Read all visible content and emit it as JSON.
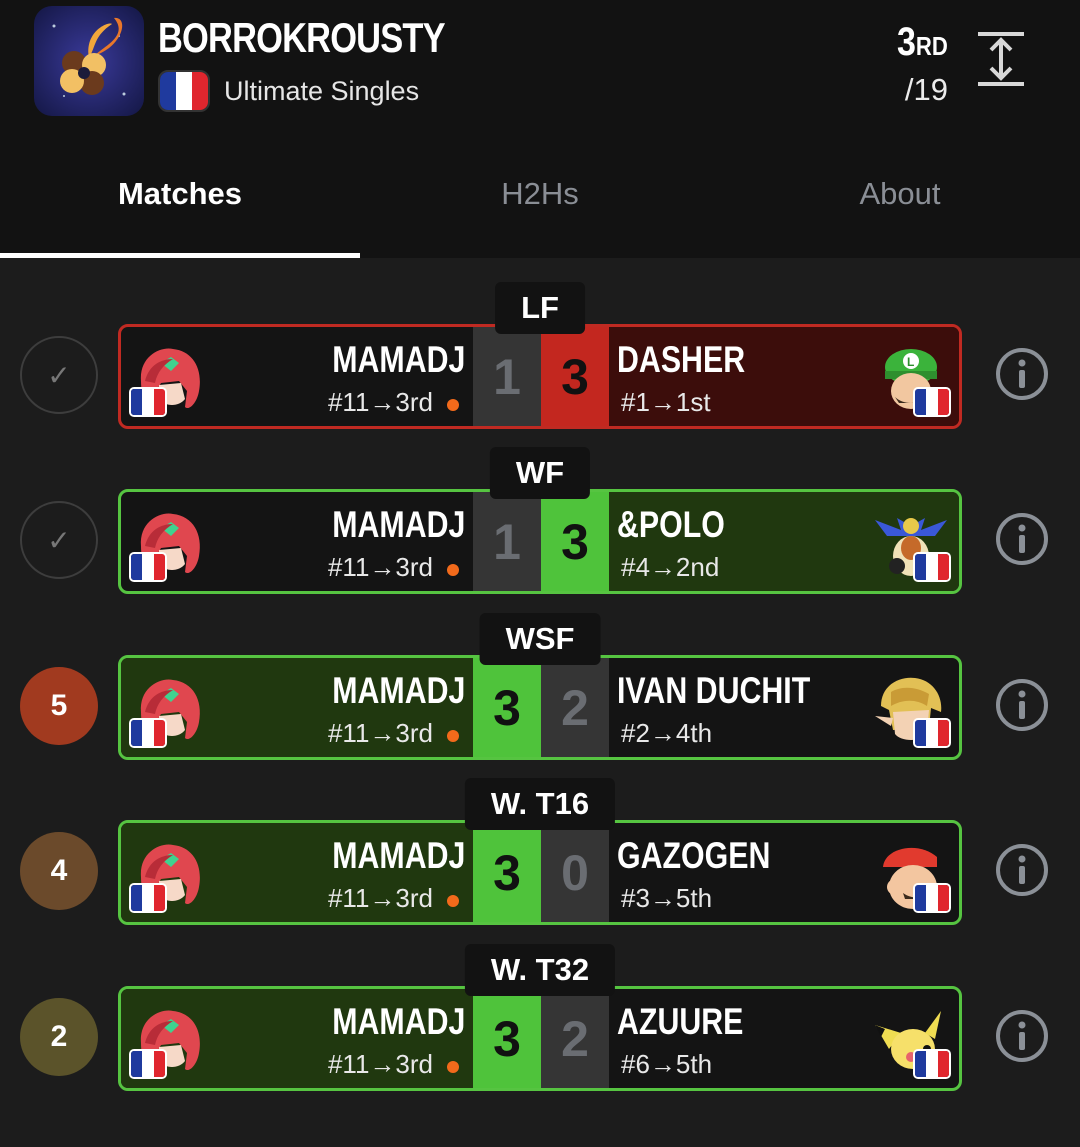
{
  "header": {
    "event_name": "BORROKROUSTY",
    "game": "Ultimate Singles",
    "placement": "3",
    "placement_suffix": "RD",
    "total": "/19",
    "logo_icon": "basque-lauburu-logo",
    "expand_icon": "expand-vertical-icon"
  },
  "tabs": [
    {
      "label": "Matches",
      "active": true
    },
    {
      "label": "H2Hs",
      "active": false
    },
    {
      "label": "About",
      "active": false
    }
  ],
  "colors": {
    "win": "#4fc33b",
    "loss": "#c3271f",
    "seed_dot": "#f26a1b"
  },
  "matches": [
    {
      "round": "LF",
      "status": {
        "type": "check",
        "label": "✓"
      },
      "left": {
        "name": "MAMADJ",
        "seed": "#11→3rd",
        "character": "pyra-icon",
        "flag": "fr"
      },
      "right": {
        "name": "DASHER",
        "seed": "#1→1st",
        "character": "luigi-icon",
        "flag": "fr"
      },
      "score_left": "1",
      "score_right": "3",
      "result": "loss"
    },
    {
      "round": "WF",
      "status": {
        "type": "check",
        "label": "✓"
      },
      "left": {
        "name": "MAMADJ",
        "seed": "#11→3rd",
        "character": "pyra-icon",
        "flag": "fr"
      },
      "right": {
        "name": "&POLO",
        "seed": "#4→2nd",
        "character": "king-k-rool-icon",
        "flag": "fr"
      },
      "score_left": "1",
      "score_right": "3",
      "result": "loss-green"
    },
    {
      "round": "WSF",
      "status": {
        "type": "number",
        "label": "5",
        "color": "#a13a1f"
      },
      "left": {
        "name": "MAMADJ",
        "seed": "#11→3rd",
        "character": "pyra-icon",
        "flag": "fr"
      },
      "right": {
        "name": "IVAN DUCHIT",
        "seed": "#2→4th",
        "character": "link-icon",
        "flag": "fr"
      },
      "score_left": "3",
      "score_right": "2",
      "result": "win"
    },
    {
      "round": "W. T16",
      "status": {
        "type": "number",
        "label": "4",
        "color": "#6b4a2b"
      },
      "left": {
        "name": "MAMADJ",
        "seed": "#11→3rd",
        "character": "pyra-icon",
        "flag": "fr"
      },
      "right": {
        "name": "GAZOGEN",
        "seed": "#3→5th",
        "character": "mario-icon",
        "flag": "fr"
      },
      "score_left": "3",
      "score_right": "0",
      "result": "win"
    },
    {
      "round": "W. T32",
      "status": {
        "type": "number",
        "label": "2",
        "color": "#5b532a"
      },
      "left": {
        "name": "MAMADJ",
        "seed": "#11→3rd",
        "character": "pyra-icon",
        "flag": "fr"
      },
      "right": {
        "name": "AZUURE",
        "seed": "#6→5th",
        "character": "pichu-icon",
        "flag": "fr"
      },
      "score_left": "3",
      "score_right": "2",
      "result": "win"
    }
  ]
}
